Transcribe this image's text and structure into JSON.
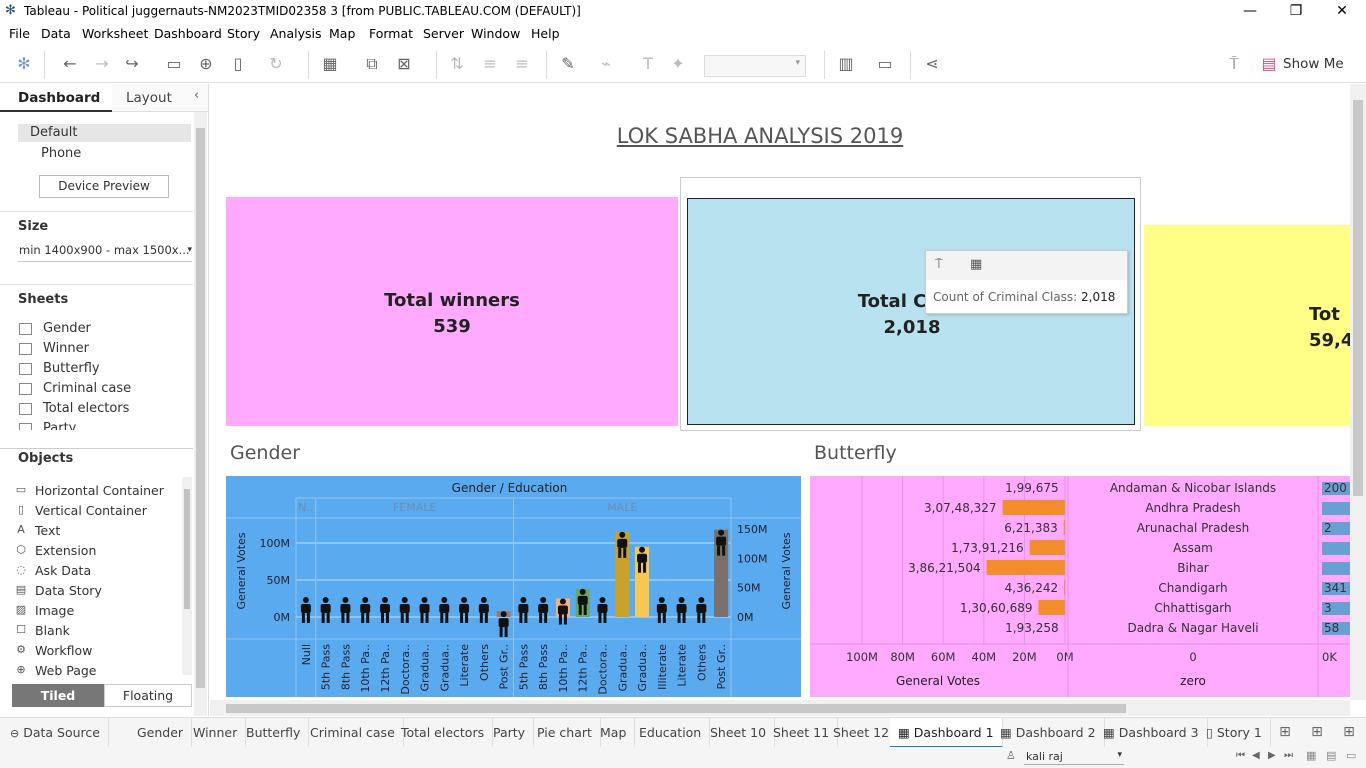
{
  "window": {
    "title": "Tableau - Political juggernauts-NM2023TMID02358 3 [from PUBLIC.TABLEAU.COM (DEFAULT)]"
  },
  "menu": [
    "File",
    "Data",
    "Worksheet",
    "Dashboard",
    "Story",
    "Analysis",
    "Map",
    "Format",
    "Server",
    "Window",
    "Help"
  ],
  "toolbar": {
    "show_me": "Show Me"
  },
  "left_panel": {
    "tab_dashboard": "Dashboard",
    "tab_layout": "Layout",
    "device_default": "Default",
    "device_phone": "Phone",
    "device_preview": "Device Preview",
    "size_label": "Size",
    "size_value": "min 1400x900 - max 1500x...",
    "sheets_label": "Sheets",
    "sheets": [
      "Gender",
      "Winner",
      "Butterfly",
      "Criminal case",
      "Total electors",
      "Party"
    ],
    "objects_label": "Objects",
    "objects": [
      "Horizontal Container",
      "Vertical Container",
      "Text",
      "Extension",
      "Ask Data",
      "Data Story",
      "Image",
      "Blank",
      "Workflow",
      "Web Page"
    ],
    "tiled": "Tiled",
    "floating": "Floating"
  },
  "dashboard": {
    "title": "LOK SABHA ANALYSIS 2019",
    "kpis": [
      {
        "label": "Total winners",
        "value": "539",
        "color": "#ffaaff"
      },
      {
        "label": "Total Crimi",
        "value": "2,018",
        "color": "#b9e2f0"
      },
      {
        "label": "Tot",
        "value": "59,4",
        "color": "#ffff88"
      }
    ],
    "tooltip": {
      "label": "Count of Criminal Class:",
      "value": "2,018"
    },
    "gender_title": "Gender",
    "butterfly_title": "Butterfly"
  },
  "chart_data": [
    {
      "type": "bar",
      "title": "Gender / Education",
      "ylabel": "General Votes",
      "y_left_ticks": [
        "100M",
        "50M",
        "0M"
      ],
      "y_right_ticks": [
        "150M",
        "100M",
        "50M",
        "0M"
      ],
      "groups": [
        {
          "name": "N..",
          "categories": [
            "Null"
          ]
        },
        {
          "name": "FEMALE",
          "categories": [
            "5th Pass",
            "8th Pass",
            "10th Pa..",
            "12th Pa..",
            "Doctora..",
            "Gradua..",
            "Gradua..",
            "Literate",
            "Others",
            "Post Gr.."
          ]
        },
        {
          "name": "MALE",
          "categories": [
            "5th Pass",
            "8th Pass",
            "10th Pa..",
            "12th Pa..",
            "Doctora..",
            "Gradua..",
            "Gradua..",
            "Illiterate",
            "Literate",
            "Others",
            "Post Gr.."
          ]
        }
      ],
      "values": [
        0,
        0,
        0,
        0,
        0,
        0,
        0,
        0,
        0,
        0,
        8,
        0,
        0,
        25,
        38,
        0,
        115,
        95,
        0,
        0,
        0,
        118
      ],
      "bar_colors": [
        "#5b9bd5",
        "#5b9bd5",
        "#5b9bd5",
        "#5b9bd5",
        "#5b9bd5",
        "#5b9bd5",
        "#5b9bd5",
        "#5b9bd5",
        "#5b9bd5",
        "#5b9bd5",
        "#a0786e",
        "#5b9bd5",
        "#5b9bd5",
        "#f4b183",
        "#6aaa60",
        "#5b9bd5",
        "#c9a227",
        "#f9c74f",
        "#5b9bd5",
        "#5b9bd5",
        "#5b9bd5",
        "#7b6f6b"
      ]
    },
    {
      "type": "bar",
      "title": "Butterfly",
      "xlabel_left": "General Votes",
      "xlabel_mid": "zero",
      "x_ticks": [
        "100M",
        "80M",
        "60M",
        "40M",
        "20M",
        "0M"
      ],
      "mid_tick": "0",
      "right_tick": "0K",
      "categories": [
        "Andaman & Nicobar Islands",
        "Andhra Pradesh",
        "Arunachal Pradesh",
        "Assam",
        "Bihar",
        "Chandigarh",
        "Chhattisgarh",
        "Dadra & Nagar Haveli"
      ],
      "value_labels": [
        "1,99,675",
        "3,07,48,327",
        "6,21,383",
        "1,73,91,216",
        "3,86,21,504",
        "4,36,242",
        "1,30,60,689",
        "1,93,258"
      ],
      "values": [
        199675,
        30748327,
        621383,
        17391216,
        38621504,
        436242,
        13060689,
        193258
      ],
      "right_labels": [
        "200",
        "",
        "2",
        "",
        "",
        "341",
        "3",
        "58"
      ]
    }
  ],
  "tabs": [
    "Data Source",
    "Gender",
    "Winner",
    "Butterfly",
    "Criminal case",
    "Total electors",
    "Party",
    "Pie chart",
    "Map",
    "Education",
    "Sheet 10",
    "Sheet 11",
    "Sheet 12",
    "Dashboard 1",
    "Dashboard 2",
    "Dashboard 3",
    "Story 1"
  ],
  "user": "kali raj"
}
